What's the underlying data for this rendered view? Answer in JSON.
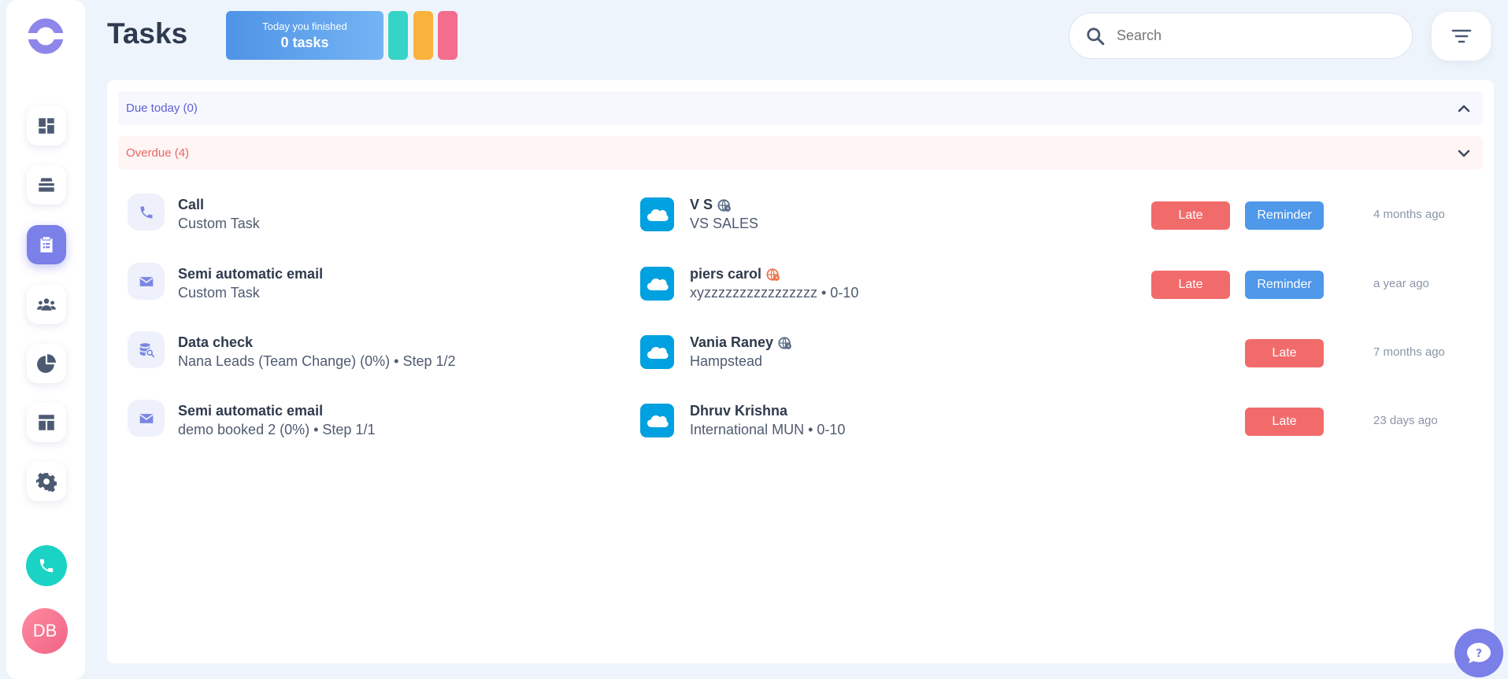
{
  "header": {
    "title": "Tasks",
    "finished_line1": "Today you finished",
    "finished_line2": "0 tasks",
    "pill_colors": [
      "#36d4c6",
      "#f9b23c",
      "#f36d8e"
    ]
  },
  "search": {
    "placeholder": "Search",
    "value": ""
  },
  "user": {
    "initials": "DB"
  },
  "sidebar": {
    "items": [
      {
        "icon": "dashboard-icon",
        "active": false
      },
      {
        "icon": "inbox-stack-icon",
        "active": false
      },
      {
        "icon": "tasks-clipboard-icon",
        "active": true
      },
      {
        "icon": "contacts-people-icon",
        "active": false
      },
      {
        "icon": "reports-pie-icon",
        "active": false
      },
      {
        "icon": "templates-layout-icon",
        "active": false
      },
      {
        "icon": "settings-gear-icon",
        "active": false
      }
    ]
  },
  "groups": {
    "due_today": {
      "label": "Due today (0)",
      "expanded": false,
      "color": "#5d62d6"
    },
    "overdue": {
      "label": "Overdue (4)",
      "expanded": true,
      "color": "#e86565"
    }
  },
  "tasks": [
    {
      "type_icon": "phone-icon",
      "title": "Call",
      "subtitle": "Custom Task",
      "contact_name": "V S",
      "contact_globe_color": "#5a6b86",
      "contact_sub": "VS SALES",
      "badges": [
        "Late",
        "Reminder"
      ],
      "time": "4 months ago"
    },
    {
      "type_icon": "mail-icon",
      "title": "Semi automatic email",
      "subtitle": "Custom Task",
      "contact_name": "piers carol",
      "contact_globe_color": "#f0714b",
      "contact_sub": "xyzzzzzzzzzzzzzzzz • 0-10",
      "badges": [
        "Late",
        "Reminder"
      ],
      "time": "a year ago"
    },
    {
      "type_icon": "data-check-icon",
      "title": "Data check",
      "subtitle": "Nana Leads (Team Change) (0%) • Step 1/2",
      "contact_name": "Vania Raney",
      "contact_globe_color": "#5a6b86",
      "contact_sub": "Hampstead",
      "badges": [
        "Late"
      ],
      "time": "7 months ago"
    },
    {
      "type_icon": "mail-icon",
      "title": "Semi automatic email",
      "subtitle": "demo booked 2 (0%) • Step 1/1",
      "contact_name": "Dhruv Krishna",
      "contact_globe_color": "",
      "contact_sub": "International MUN • 0-10",
      "badges": [
        "Late"
      ],
      "time": "23 days ago"
    }
  ],
  "colors": {
    "accent": "#7b7fe8",
    "late": "#f26b6b",
    "reminder": "#4f98ea",
    "salesforce": "#00a1e0",
    "call_button": "#1ad3c4"
  }
}
